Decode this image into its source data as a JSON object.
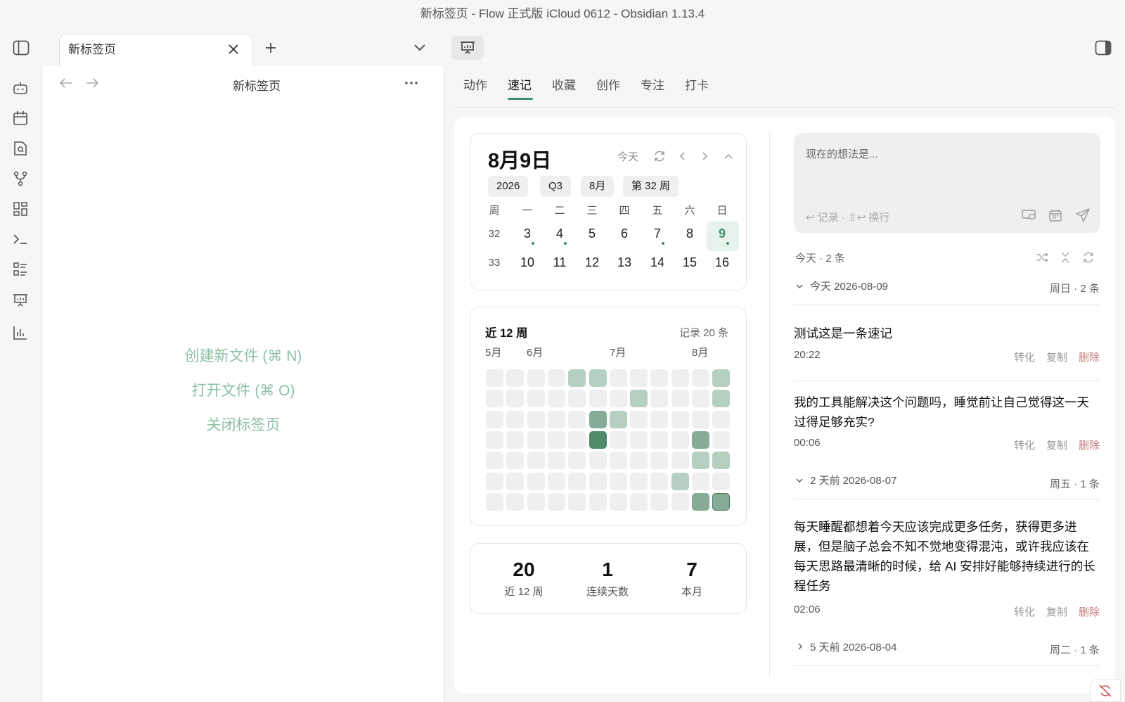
{
  "window": {
    "title": "新标签页 - Flow 正式版 iCloud 0612 - Obsidian 1.13.4"
  },
  "tabbar": {
    "active_tab": "新标签页",
    "icons": [
      "sidebar-left-icon",
      "close-icon",
      "plus-icon",
      "chevron-down-icon",
      "presentation-icon",
      "sidebar-right-icon"
    ]
  },
  "ribbon": {
    "icons": [
      "robot-icon",
      "calendar-icon",
      "file-search-icon",
      "git-branch-icon",
      "dashboard-icon",
      "terminal-icon",
      "list-icon",
      "presentation-icon",
      "bar-chart-icon"
    ]
  },
  "left_pane": {
    "title": "新标签页",
    "actions": [
      "创建新文件 (⌘ N)",
      "打开文件 (⌘ O)",
      "关闭标签页"
    ]
  },
  "right_pane": {
    "tabs": [
      "动作",
      "速记",
      "收藏",
      "创作",
      "专注",
      "打卡"
    ],
    "active_tab": "速记",
    "calendar": {
      "date_title": "8月9日",
      "today_button": "今天",
      "chips": [
        "2026",
        "Q3",
        "8月",
        "第 32 周"
      ],
      "weekday_header": [
        "周",
        "一",
        "二",
        "三",
        "四",
        "五",
        "六",
        "日"
      ],
      "weeks": [
        {
          "week": "32",
          "days": [
            "3",
            "4",
            "5",
            "6",
            "7",
            "8",
            "9"
          ],
          "dots": [
            true,
            true,
            false,
            false,
            true,
            false,
            true
          ],
          "selected": 6
        },
        {
          "week": "33",
          "days": [
            "10",
            "11",
            "12",
            "13",
            "14",
            "15",
            "16"
          ],
          "dots": [
            false,
            false,
            false,
            false,
            false,
            false,
            false
          ],
          "selected": -1
        }
      ]
    },
    "heatmap": {
      "title": "近 12 周",
      "summary": "记录 20 条",
      "month_labels": [
        "5月",
        "6月",
        "7月",
        "8月"
      ],
      "levels": [
        [
          0,
          0,
          0,
          0,
          0,
          0,
          0
        ],
        [
          0,
          0,
          0,
          0,
          0,
          0,
          0
        ],
        [
          0,
          0,
          0,
          0,
          0,
          0,
          0
        ],
        [
          0,
          0,
          0,
          0,
          0,
          0,
          0
        ],
        [
          2,
          0,
          0,
          0,
          0,
          0,
          0
        ],
        [
          2,
          0,
          3,
          4,
          0,
          0,
          0
        ],
        [
          0,
          0,
          2,
          0,
          0,
          0,
          0
        ],
        [
          0,
          2,
          0,
          0,
          0,
          0,
          0
        ],
        [
          0,
          0,
          0,
          0,
          0,
          0,
          0
        ],
        [
          0,
          0,
          0,
          0,
          0,
          2,
          0
        ],
        [
          0,
          0,
          0,
          3,
          2,
          0,
          3
        ],
        [
          2,
          2,
          0,
          0,
          2,
          0,
          3
        ]
      ],
      "colors": [
        "#efefef",
        "#d9e8df",
        "#b5cfc0",
        "#86ac97",
        "#4f8a6b"
      ]
    },
    "stats": [
      {
        "value": "20",
        "label": "近 12 周"
      },
      {
        "value": "1",
        "label": "连续天数"
      },
      {
        "value": "7",
        "label": "本月"
      }
    ],
    "composer": {
      "placeholder": "现在的想法是...",
      "hint": "↩ 记录 · ⇧↩ 换行"
    },
    "memo_list": {
      "summary": "今天 · 2 条",
      "groups": [
        {
          "label": "今天 2026-08-09",
          "meta": "周日 · 2 条",
          "expanded": true,
          "memos": [
            {
              "text": "测试这是一条速记",
              "time": "20:22"
            },
            {
              "text": "我的工具能解决这个问题吗，睡觉前让自己觉得这一天过得足够充实?",
              "time": "00:06"
            }
          ]
        },
        {
          "label": "2 天前 2026-08-07",
          "meta": "周五 · 1 条",
          "expanded": true,
          "memos": [
            {
              "text": "每天睡醒都想着今天应该完成更多任务，获得更多进展，但是脑子总会不知不觉地变得混沌，或许我应该在每天思路最清晰的时候，给 AI 安排好能够持续进行的长程任务",
              "time": "02:06"
            }
          ]
        },
        {
          "label": "5 天前 2026-08-04",
          "meta": "周二 · 1 条",
          "expanded": false,
          "memos": []
        }
      ],
      "actions": [
        "转化",
        "复制",
        "删除"
      ]
    }
  },
  "colors": {
    "accent": "#3f8f6d",
    "danger": "#c87c7c",
    "link": "#8cc0a3"
  }
}
